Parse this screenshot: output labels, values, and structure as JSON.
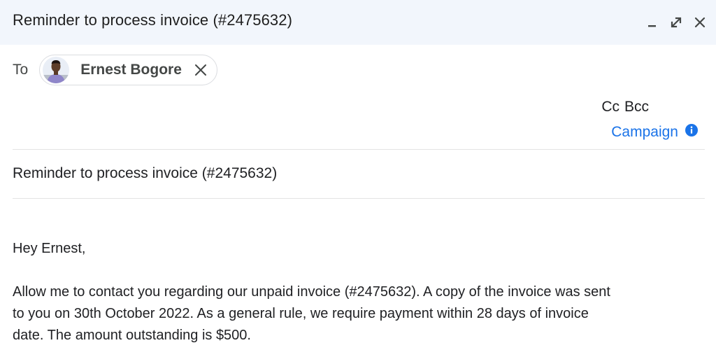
{
  "window": {
    "title": "Reminder to process invoice (#2475632)",
    "icons": [
      "minimize-icon",
      "pop-out-icon",
      "close-icon"
    ]
  },
  "recipients": {
    "to_label": "To",
    "chips": [
      {
        "name": "Ernest Bogore",
        "avatar": "avatar-photo"
      }
    ]
  },
  "header_actions": {
    "cc_label": "Cc",
    "bcc_label": "Bcc",
    "campaign_label": "Campaign",
    "campaign_icon": "info-icon"
  },
  "subject": "Reminder to process invoice (#2475632)",
  "body": {
    "greeting": "Hey Ernest,",
    "paragraph1_line1": "Allow me to contact you regarding our unpaid invoice (#2475632). A copy of the invoice was sent",
    "paragraph1_line2": "to you on 30th October 2022. As a general rule, we require payment within 28 days of invoice",
    "paragraph1_line3": "date. The amount outstanding is $500."
  },
  "colors": {
    "titlebar_bg": "#f2f6fc",
    "link_blue": "#1a73e8",
    "divider": "#e3e3e3"
  }
}
